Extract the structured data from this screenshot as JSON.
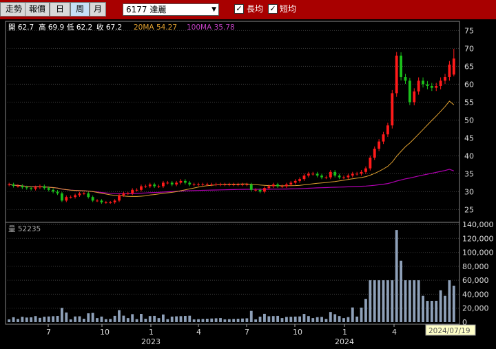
{
  "toolbar": {
    "period_buttons": [
      {
        "label": "走勢",
        "active": false
      },
      {
        "label": "報價",
        "active": false
      },
      {
        "label": "日",
        "active": false
      },
      {
        "label": "周",
        "active": true
      },
      {
        "label": "月",
        "active": false
      }
    ],
    "stock_selector": "6177 達麗",
    "checkboxes": [
      {
        "label": "長均",
        "checked": true
      },
      {
        "label": "短均",
        "checked": true
      }
    ]
  },
  "info_bar": {
    "open": "開 62.7",
    "high": "高 69.9",
    "low": "低 62.2",
    "close": "收 67.2",
    "ma20": "20MA 54.27",
    "ma100": "100MA 35.78"
  },
  "volume_label": "量 52235",
  "date_tooltip": "2024/07/19",
  "colors": {
    "up": "#ff1a1a",
    "down": "#1bbf1b",
    "ma20": "#e0a030",
    "ma100": "#b000b0",
    "volume": "#8ea0b8",
    "toolbar": "#a80000"
  },
  "chart_data": [
    {
      "type": "candlestick",
      "interval": "weekly",
      "y_ticks": [
        25,
        30,
        35,
        40,
        45,
        50,
        55,
        60,
        65,
        70,
        75
      ],
      "ylim": [
        22,
        77
      ],
      "x_ticks": [
        "7",
        "10",
        "1",
        "4",
        "7",
        "10",
        "1",
        "4",
        "7"
      ],
      "year_labels": [
        "2023",
        "2024"
      ],
      "close": [
        32.0,
        31.6,
        31.6,
        31.2,
        31.0,
        30.8,
        31.2,
        31.5,
        31.0,
        30.5,
        30.0,
        29.5,
        27.5,
        28.5,
        28.5,
        29.0,
        29.5,
        29.5,
        28.5,
        27.5,
        27.5,
        27.0,
        27.0,
        27.0,
        27.5,
        29.0,
        29.5,
        29.5,
        30.5,
        30.5,
        31.5,
        31.5,
        32.0,
        31.5,
        31.5,
        32.5,
        32.5,
        32.0,
        32.5,
        33.0,
        32.5,
        32.0,
        32.0,
        32.0,
        32.0,
        32.0,
        32.0,
        32.0,
        32.0,
        32.0,
        32.0,
        32.0,
        32.0,
        32.0,
        32.0,
        30.5,
        30.5,
        30.0,
        31.0,
        31.5,
        32.0,
        31.5,
        31.5,
        32.0,
        32.5,
        33.0,
        33.5,
        34.5,
        35.0,
        35.0,
        34.5,
        34.0,
        34.0,
        35.5,
        34.5,
        34.0,
        34.0,
        34.5,
        35.0,
        35.0,
        35.5,
        36.5,
        39.5,
        42.0,
        44.0,
        46.0,
        48.5,
        57.5,
        68.0,
        62.0,
        61.0,
        55.0,
        58.0,
        61.0,
        60.0,
        59.5,
        59.0,
        59.5,
        61.0,
        62.0,
        65.5,
        67.2
      ],
      "volume_yticks": [
        0,
        20000,
        40000,
        60000,
        80000,
        100000,
        120000,
        140000
      ],
      "ma20_last": 54.27,
      "ma100_last": 35.78,
      "last_ohlc": {
        "open": 62.7,
        "high": 69.9,
        "low": 62.2,
        "close": 67.2,
        "volume": 52235
      }
    }
  ]
}
